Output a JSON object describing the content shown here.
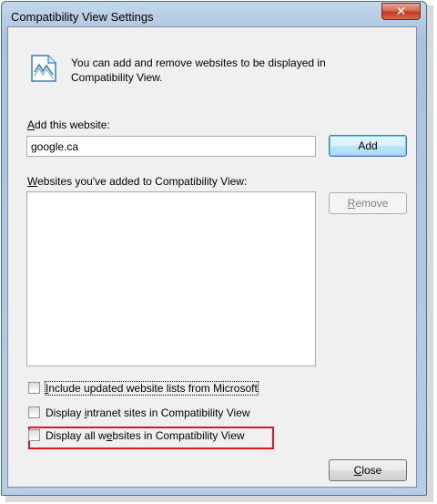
{
  "window": {
    "title": "Compatibility View Settings",
    "close_glyph": "✕"
  },
  "intro": {
    "icon": "compatibility-view-icon",
    "text_line1": "You can add and remove websites to be displayed in",
    "text_line2": "Compatibility View."
  },
  "add_website": {
    "label_accel": "A",
    "label_rest": "dd this website:",
    "input_value": "google.ca",
    "button_label": "Add"
  },
  "website_list": {
    "label_accel": "W",
    "label_rest": "ebsites you've added to Compatibility View:",
    "items": [],
    "remove_accel": "R",
    "remove_rest": "emove"
  },
  "options": [
    {
      "pre": "",
      "accel": "I",
      "post": "nclude updated website lists from Microsoft",
      "checked": false
    },
    {
      "pre": "Display ",
      "accel": "i",
      "post": "ntranet sites in Compatibility View",
      "checked": false
    },
    {
      "pre": "Display all w",
      "accel": "e",
      "post": "bsites in Compatibility View",
      "checked": false
    }
  ],
  "footer": {
    "close_accel": "C",
    "close_rest": "lose"
  },
  "colors": {
    "highlight": "#e8141c",
    "titlebar": "#a9c2dc",
    "close_button": "#c2391f"
  }
}
